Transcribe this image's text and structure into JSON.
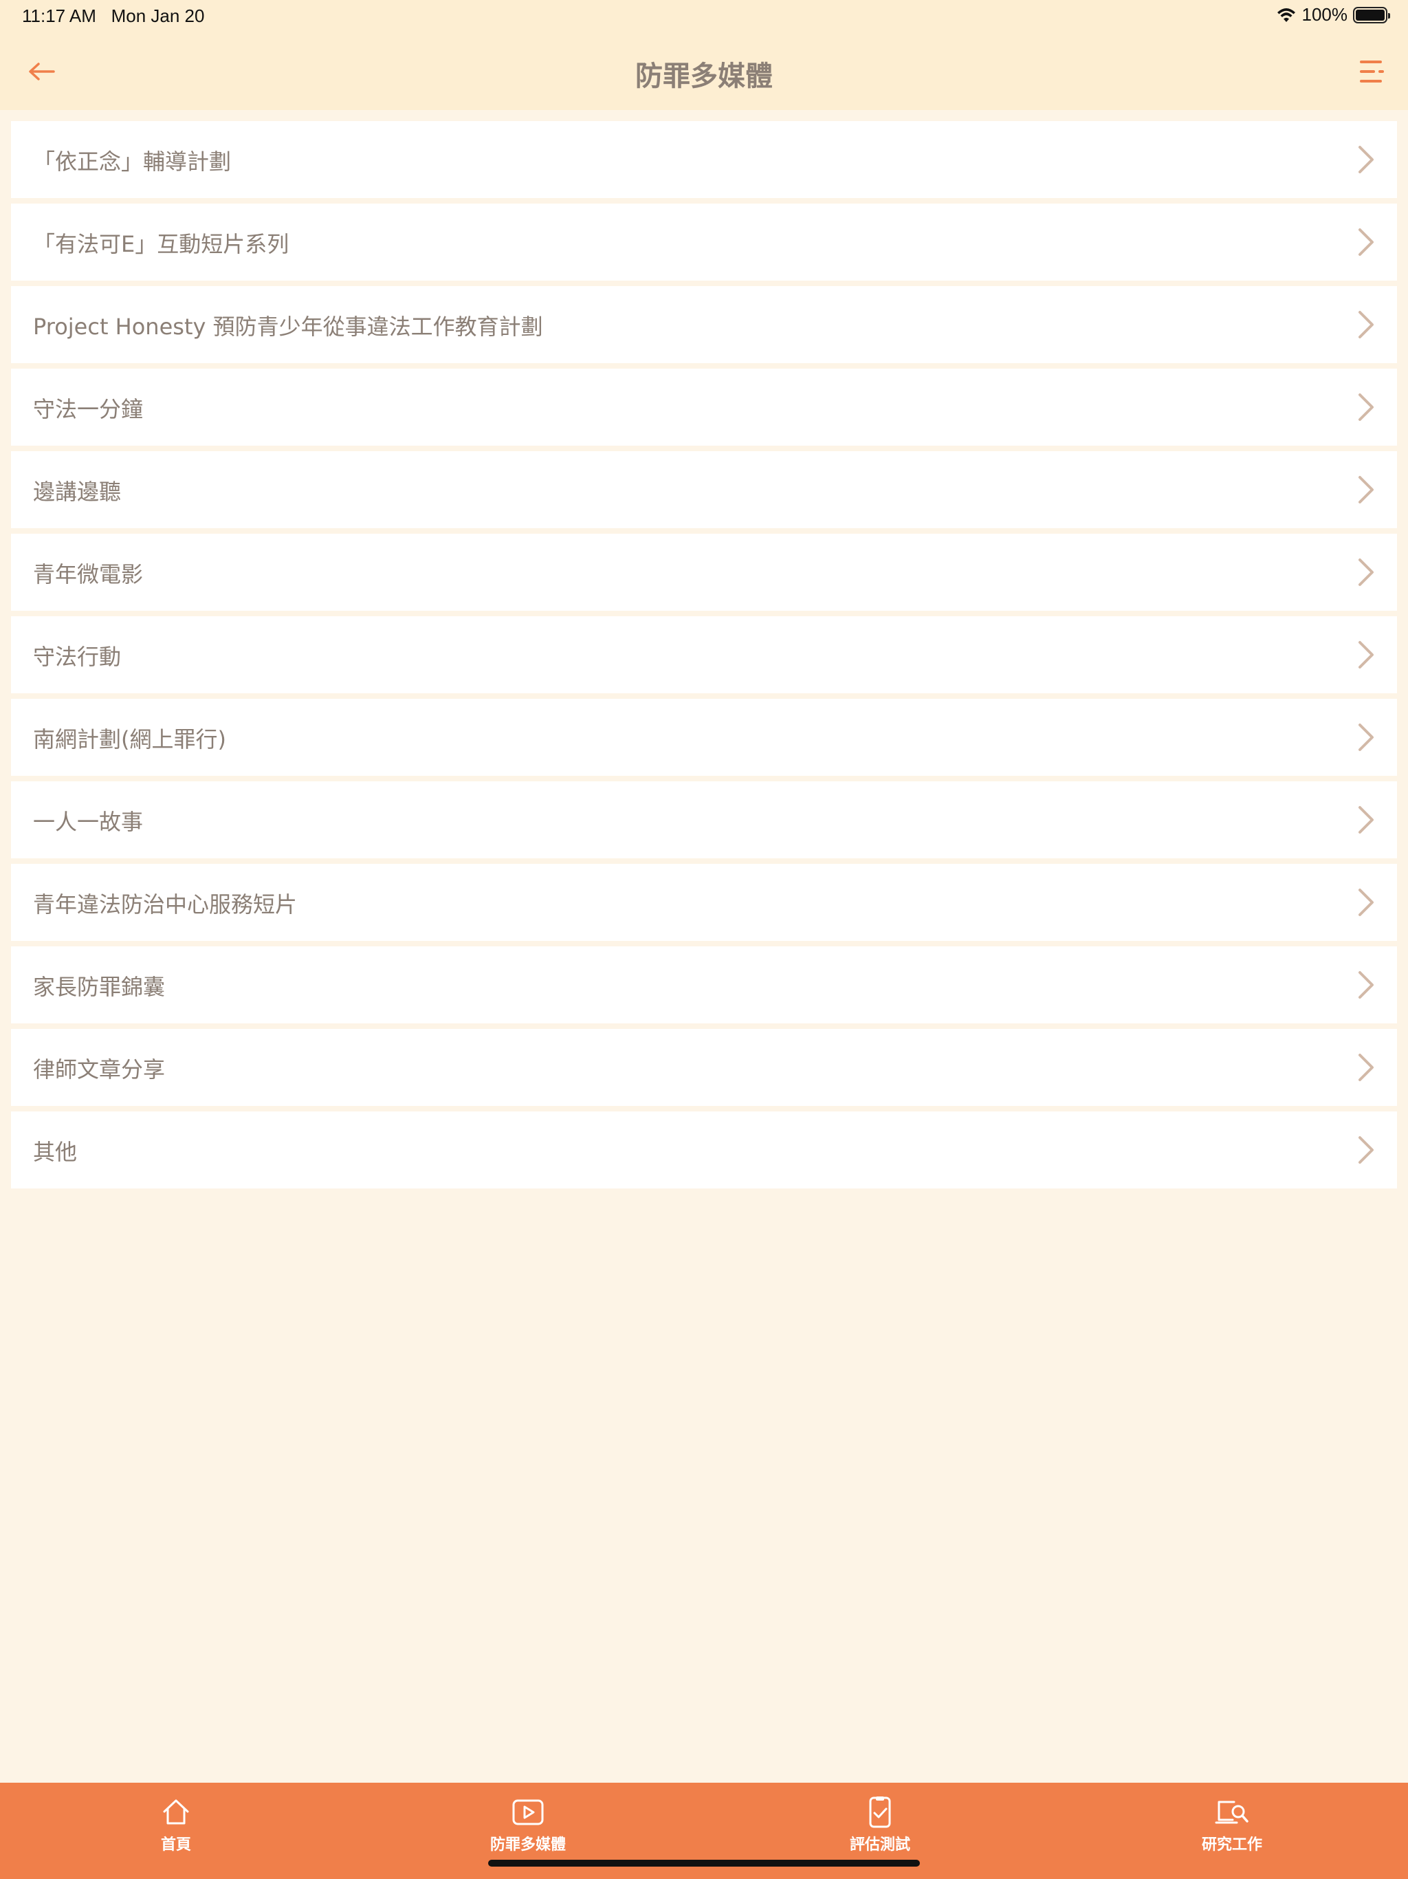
{
  "status_bar": {
    "time": "11:17 AM",
    "date": "Mon Jan 20",
    "battery": "100%"
  },
  "header": {
    "title": "防罪多媒體",
    "back_icon": "back-arrow-icon",
    "menu_icon": "menu-icon"
  },
  "colors": {
    "accent": "#f07f4a",
    "header_bg": "#fdeed2",
    "page_bg": "#fdf4e6",
    "text": "#8b7f76",
    "chevron": "#d2b9a7"
  },
  "list": {
    "items": [
      {
        "label": "「依正念」輔導計劃"
      },
      {
        "label": "「有法可E」互動短片系列"
      },
      {
        "label": "Project Honesty 預防青少年從事違法工作教育計劃"
      },
      {
        "label": "守法一分鐘"
      },
      {
        "label": "邊講邊聽"
      },
      {
        "label": "青年微電影"
      },
      {
        "label": "守法行動"
      },
      {
        "label": "南網計劃(網上罪行)"
      },
      {
        "label": "一人一故事"
      },
      {
        "label": "青年違法防治中心服務短片"
      },
      {
        "label": "家長防罪錦囊"
      },
      {
        "label": "律師文章分享"
      },
      {
        "label": "其他"
      }
    ]
  },
  "tabs": [
    {
      "label": "首頁",
      "icon": "home-icon"
    },
    {
      "label": "防罪多媒體",
      "icon": "play-video-icon"
    },
    {
      "label": "評估測試",
      "icon": "checklist-icon"
    },
    {
      "label": "研究工作",
      "icon": "research-icon"
    }
  ]
}
